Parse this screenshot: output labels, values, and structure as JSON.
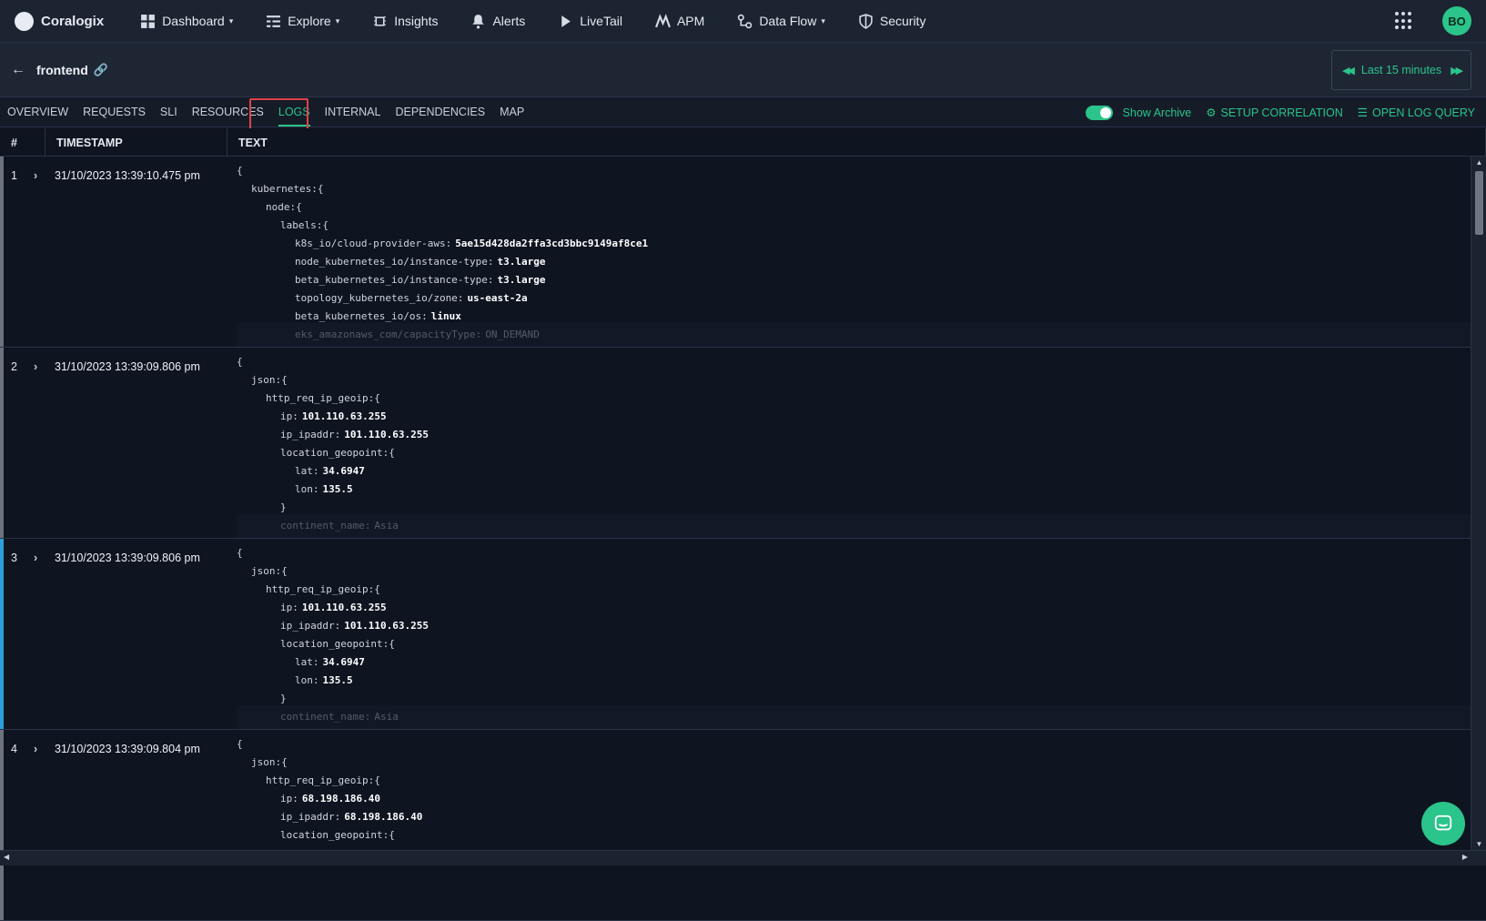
{
  "nav": {
    "brand": "Coralogix",
    "items": [
      {
        "label": "Dashboard",
        "icon": "dashboard-icon",
        "caret": true
      },
      {
        "label": "Explore",
        "icon": "explore-icon",
        "caret": true
      },
      {
        "label": "Insights",
        "icon": "chip-icon",
        "caret": false
      },
      {
        "label": "Alerts",
        "icon": "bell-icon",
        "caret": false
      },
      {
        "label": "LiveTail",
        "icon": "play-icon",
        "caret": false
      },
      {
        "label": "APM",
        "icon": "apm-icon",
        "caret": false
      },
      {
        "label": "Data Flow",
        "icon": "dataflow-icon",
        "caret": true
      },
      {
        "label": "Security",
        "icon": "shield-icon",
        "caret": false
      }
    ],
    "avatar": "BO"
  },
  "header": {
    "service": "frontend",
    "time_range": "Last 15 minutes"
  },
  "tabs": [
    "OVERVIEW",
    "REQUESTS",
    "SLI",
    "RESOURCES",
    "LOGS",
    "INTERNAL",
    "DEPENDENCIES",
    "MAP"
  ],
  "active_tab": "LOGS",
  "actions": {
    "show_archive": "Show Archive",
    "setup_correlation": "SETUP CORRELATION",
    "open_log_query": "OPEN LOG QUERY"
  },
  "table": {
    "headers": [
      "#",
      "TIMESTAMP",
      "TEXT"
    ],
    "rows": [
      {
        "num": "1",
        "timestamp": "31/10/2023 13:39:10.475 pm",
        "severity_color": "#6d737d",
        "lines": [
          {
            "indent": 0,
            "key": "{",
            "val": ""
          },
          {
            "indent": 1,
            "key": "kubernetes:{",
            "val": ""
          },
          {
            "indent": 2,
            "key": "node:{",
            "val": ""
          },
          {
            "indent": 3,
            "key": "labels:{",
            "val": ""
          },
          {
            "indent": 4,
            "key": "k8s_io/cloud-provider-aws:",
            "val": "5ae15d428da2ffa3cd3bbc9149af8ce1"
          },
          {
            "indent": 4,
            "key": "node_kubernetes_io/instance-type:",
            "val": "t3.large"
          },
          {
            "indent": 4,
            "key": "beta_kubernetes_io/instance-type:",
            "val": "t3.large"
          },
          {
            "indent": 4,
            "key": "topology_kubernetes_io/zone:",
            "val": "us-east-2a"
          },
          {
            "indent": 4,
            "key": "beta_kubernetes_io/os:",
            "val": "linux"
          },
          {
            "indent": 4,
            "key": "eks_amazonaws_com/capacityType:",
            "val": "ON_DEMAND",
            "fade": true
          }
        ]
      },
      {
        "num": "2",
        "timestamp": "31/10/2023 13:39:09.806 pm",
        "severity_color": "#6d737d",
        "lines": [
          {
            "indent": 0,
            "key": "{",
            "val": ""
          },
          {
            "indent": 1,
            "key": "json:{",
            "val": ""
          },
          {
            "indent": 2,
            "key": "http_req_ip_geoip:{",
            "val": ""
          },
          {
            "indent": 3,
            "key": "ip:",
            "val": "101.110.63.255"
          },
          {
            "indent": 3,
            "key": "ip_ipaddr:",
            "val": "101.110.63.255"
          },
          {
            "indent": 3,
            "key": "location_geopoint:{",
            "val": ""
          },
          {
            "indent": 4,
            "key": "lat:",
            "val": "34.6947"
          },
          {
            "indent": 4,
            "key": "lon:",
            "val": "135.5"
          },
          {
            "indent": 3,
            "key": "}",
            "val": ""
          },
          {
            "indent": 3,
            "key": "continent_name:",
            "val": "Asia",
            "fade": true
          }
        ]
      },
      {
        "num": "3",
        "timestamp": "31/10/2023 13:39:09.806 pm",
        "severity_color": "#2d9fd8",
        "lines": [
          {
            "indent": 0,
            "key": "{",
            "val": ""
          },
          {
            "indent": 1,
            "key": "json:{",
            "val": ""
          },
          {
            "indent": 2,
            "key": "http_req_ip_geoip:{",
            "val": ""
          },
          {
            "indent": 3,
            "key": "ip:",
            "val": "101.110.63.255"
          },
          {
            "indent": 3,
            "key": "ip_ipaddr:",
            "val": "101.110.63.255"
          },
          {
            "indent": 3,
            "key": "location_geopoint:{",
            "val": ""
          },
          {
            "indent": 4,
            "key": "lat:",
            "val": "34.6947"
          },
          {
            "indent": 4,
            "key": "lon:",
            "val": "135.5"
          },
          {
            "indent": 3,
            "key": "}",
            "val": ""
          },
          {
            "indent": 3,
            "key": "continent_name:",
            "val": "Asia",
            "fade": true
          }
        ]
      },
      {
        "num": "4",
        "timestamp": "31/10/2023 13:39:09.804 pm",
        "severity_color": "#6d737d",
        "lines": [
          {
            "indent": 0,
            "key": "{",
            "val": ""
          },
          {
            "indent": 1,
            "key": "json:{",
            "val": ""
          },
          {
            "indent": 2,
            "key": "http_req_ip_geoip:{",
            "val": ""
          },
          {
            "indent": 3,
            "key": "ip:",
            "val": "68.198.186.40"
          },
          {
            "indent": 3,
            "key": "ip_ipaddr:",
            "val": "68.198.186.40"
          },
          {
            "indent": 3,
            "key": "location_geopoint:{",
            "val": ""
          }
        ]
      }
    ]
  }
}
